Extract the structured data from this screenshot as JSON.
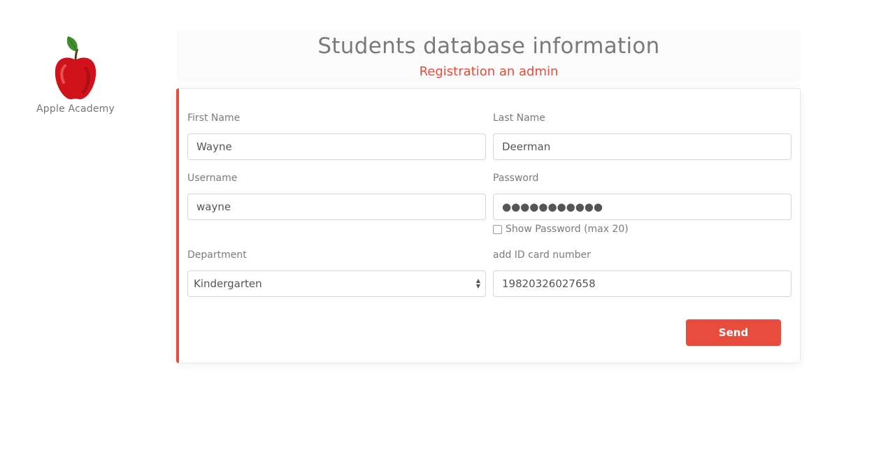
{
  "brand": {
    "logo_icon": "apple-icon",
    "name": "Apple Academy"
  },
  "header": {
    "title": "Students database information",
    "subtitle": "Registration an admin"
  },
  "form": {
    "first_name": {
      "label": "First Name",
      "value": "Wayne"
    },
    "last_name": {
      "label": "Last Name",
      "value": "Deerman"
    },
    "username": {
      "label": "Username",
      "value": "wayne"
    },
    "password": {
      "label": "Password",
      "value": "●●●●●●●●●●●"
    },
    "show_password": {
      "label": "Show Password (max 20)",
      "checked": false
    },
    "department": {
      "label": "Department",
      "value": "Kindergarten"
    },
    "id_card": {
      "label": "add ID card number",
      "value": "19820326027658"
    },
    "send_label": "Send"
  },
  "colors": {
    "accent": "#e74c3c",
    "text": "#7b7b7b",
    "border": "#d6d6d6"
  }
}
